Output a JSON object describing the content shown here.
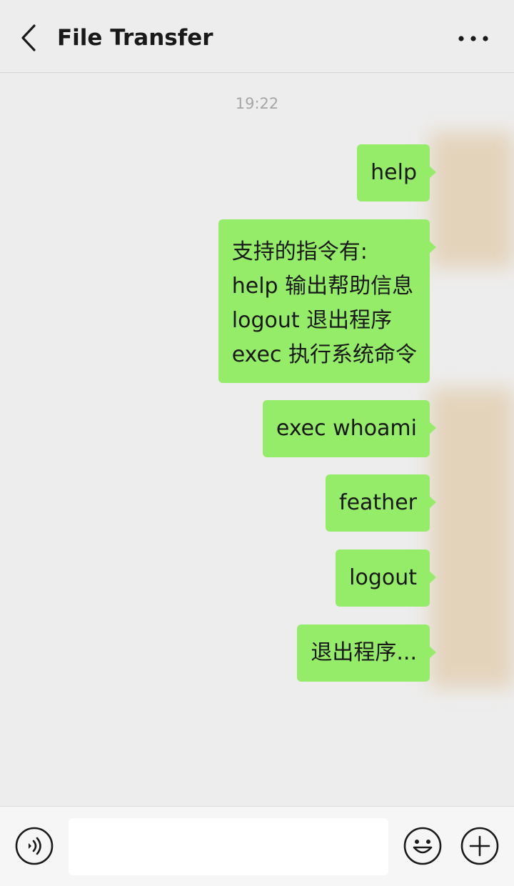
{
  "header": {
    "title": "File Transfer",
    "back_icon": "chevron-left-icon",
    "more_icon": "more-horizontal-icon"
  },
  "chat": {
    "timestamp": "19:22",
    "messages": [
      {
        "text": "help"
      },
      {
        "lines": [
          "支持的指令有:",
          "help 输出帮助信息",
          "logout 退出程序",
          "exec 执行系统命令"
        ]
      },
      {
        "text": "exec whoami"
      },
      {
        "text": "feather"
      },
      {
        "text": "logout"
      },
      {
        "text": "退出程序..."
      }
    ]
  },
  "input_bar": {
    "voice_icon": "voice-icon",
    "message_value": "",
    "emoji_icon": "emoji-icon",
    "plus_icon": "plus-icon"
  },
  "colors": {
    "background": "#ededed",
    "bubble": "#95ec69",
    "input_bar": "#f6f6f6"
  }
}
